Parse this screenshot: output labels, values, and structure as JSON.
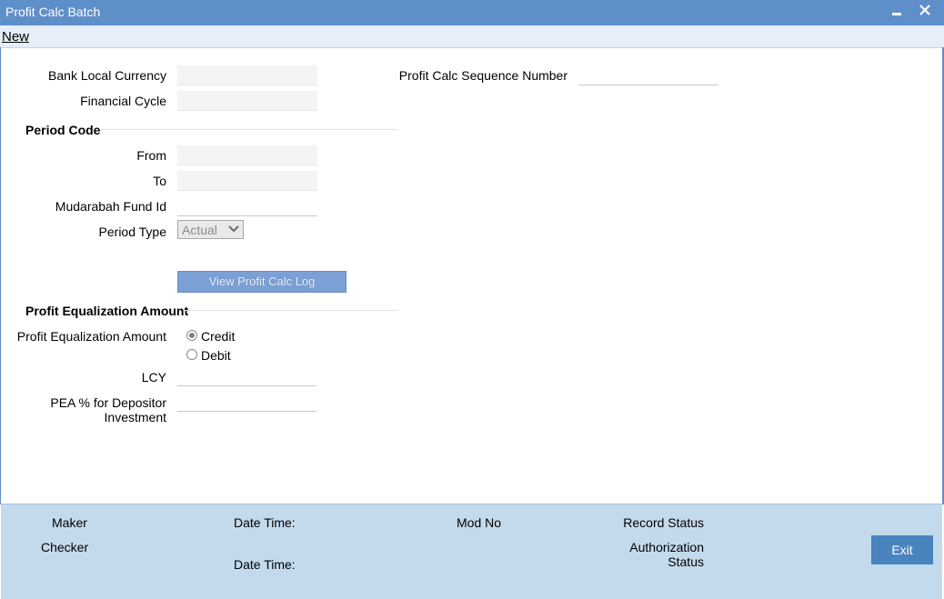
{
  "window": {
    "title": "Profit Calc Batch",
    "minimize_glyph": "▬",
    "close_glyph": "✕"
  },
  "toolbar": {
    "new_label": "New"
  },
  "form": {
    "bank_local_currency": {
      "label": "Bank Local Currency",
      "value": ""
    },
    "financial_cycle": {
      "label": "Financial Cycle",
      "value": ""
    },
    "profit_calc_seq": {
      "label": "Profit Calc Sequence Number",
      "value": ""
    },
    "period_code_section": "Period Code",
    "from": {
      "label": "From",
      "value": ""
    },
    "to": {
      "label": "To",
      "value": ""
    },
    "mudarabah_fund_id": {
      "label": "Mudarabah Fund Id",
      "value": ""
    },
    "period_type": {
      "label": "Period Type",
      "selected": "Actual",
      "chevron": "⌄"
    },
    "view_log_button": "View Profit Calc Log",
    "pea_section": "Profit Equalization Amount",
    "pea_amount_label": "Profit Equalization Amount",
    "radio_credit": {
      "label": "Credit",
      "checked": true
    },
    "radio_debit": {
      "label": "Debit",
      "checked": false
    },
    "lcy": {
      "label": "LCY",
      "value": ""
    },
    "pea_pct": {
      "label_line1": "PEA % for Depositor",
      "label_line2": "Investment",
      "value": ""
    }
  },
  "footer": {
    "maker": "Maker",
    "checker": "Checker",
    "date_time_1": "Date Time:",
    "date_time_2": "Date Time:",
    "mod_no": "Mod No",
    "record_status": "Record Status",
    "auth_status_line1": "Authorization",
    "auth_status_line2": "Status",
    "exit_button": "Exit"
  },
  "colors": {
    "title_bar": "#5f8fc9",
    "footer_bg": "#c3daed",
    "exit_button": "#4a84be",
    "view_button": "#7aa0d6"
  }
}
